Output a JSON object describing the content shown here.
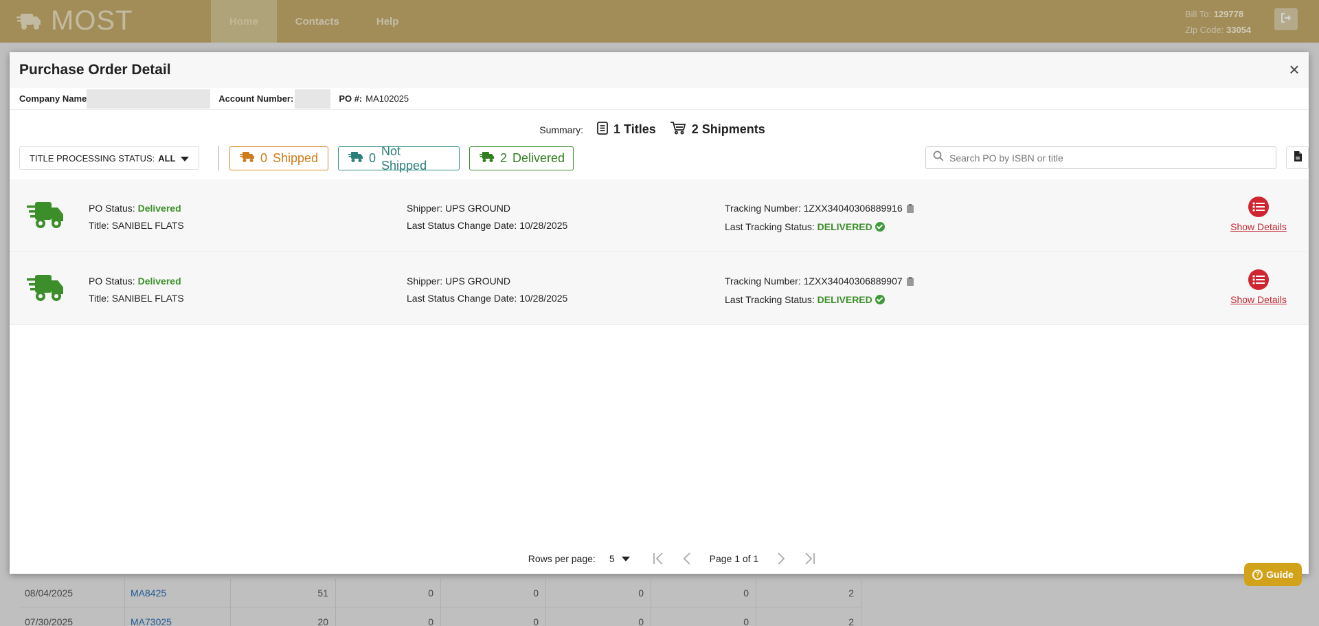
{
  "app": {
    "logo_text": "MOST"
  },
  "nav": {
    "items": [
      {
        "label": "Home"
      },
      {
        "label": "Contacts"
      },
      {
        "label": "Help"
      }
    ]
  },
  "account": {
    "bill_to_label": "Bill To:",
    "bill_to_value": "129778",
    "zip_label": "Zip Code:",
    "zip_value": "33054"
  },
  "modal": {
    "title": "Purchase Order Detail",
    "close_symbol": "×",
    "company_label": "Company Name",
    "account_label": "Account Number:",
    "po_label": "PO #:",
    "po_value": "MA102025"
  },
  "summary": {
    "label": "Summary:",
    "titles": "1 Titles",
    "shipments": "2 Shipments"
  },
  "filters": {
    "status_label": "TITLE PROCESSING STATUS:",
    "status_value": "ALL",
    "shipped_count": "0",
    "shipped_label": "Shipped",
    "not_shipped_count": "0",
    "not_shipped_label": "Not Shipped",
    "delivered_count": "2",
    "delivered_label": "Delivered",
    "search_placeholder": "Search PO by ISBN or title"
  },
  "shipments": [
    {
      "po_status_label": "PO Status:",
      "po_status": "Delivered",
      "title_label": "Title:",
      "title": "SANIBEL FLATS",
      "shipper_label": "Shipper:",
      "shipper": "UPS GROUND",
      "last_change_label": "Last Status Change Date:",
      "last_change": "10/28/2025",
      "tracking_label": "Tracking Number:",
      "tracking": "1ZXX34040306889916",
      "tracking_status_label": "Last Tracking Status:",
      "tracking_status": "DELIVERED",
      "details_label": "Show Details"
    },
    {
      "po_status_label": "PO Status:",
      "po_status": "Delivered",
      "title_label": "Title:",
      "title": "SANIBEL FLATS",
      "shipper_label": "Shipper:",
      "shipper": "UPS GROUND",
      "last_change_label": "Last Status Change Date:",
      "last_change": "10/28/2025",
      "tracking_label": "Tracking Number:",
      "tracking": "1ZXX34040306889907",
      "tracking_status_label": "Last Tracking Status:",
      "tracking_status": "DELIVERED",
      "details_label": "Show Details"
    }
  ],
  "pager": {
    "rows_label": "Rows per page:",
    "rows_value": "5",
    "page_info": "Page 1 of 1"
  },
  "background_table": {
    "rows": [
      [
        "08/04/2025",
        "MA8425",
        "51",
        "0",
        "0",
        "0",
        "0",
        "2"
      ],
      [
        "07/30/2025",
        "MA73025",
        "20",
        "0",
        "0",
        "0",
        "0",
        "2"
      ]
    ]
  },
  "guide": {
    "label": "Guide"
  },
  "colors": {
    "header": "#c6ad6c",
    "shipped": "#d07b18",
    "not_shipped": "#2b7f79",
    "delivered": "#2f7e1f",
    "details": "#cf2531",
    "guide": "#d3a21b"
  }
}
